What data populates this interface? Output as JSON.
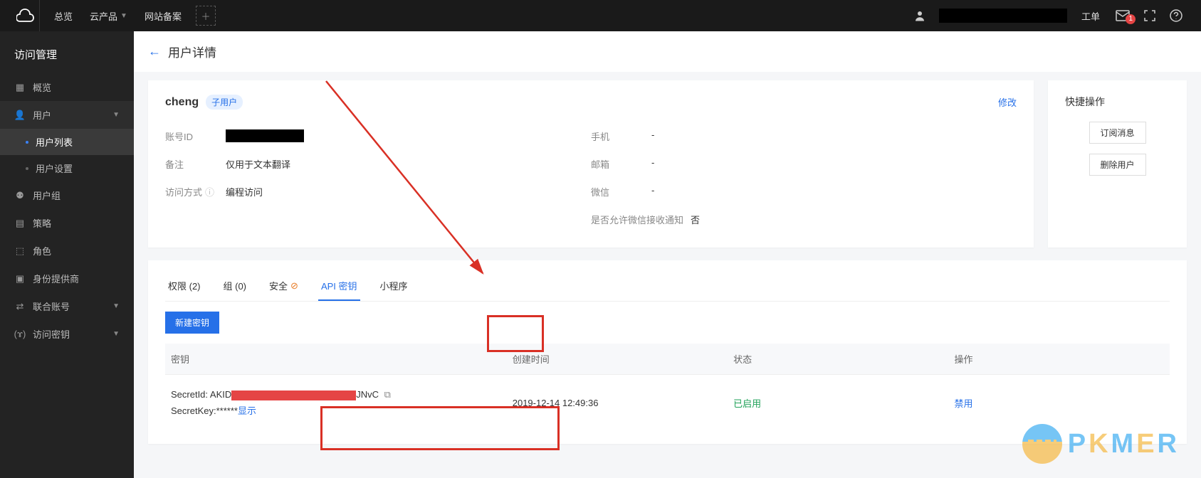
{
  "topnav": {
    "overview": "总览",
    "products": "云产品",
    "beian": "网站备案",
    "ticket": "工单"
  },
  "mail_badge": "1",
  "sidebar": {
    "title": "访问管理",
    "items": [
      {
        "label": "概览"
      },
      {
        "label": "用户"
      },
      {
        "label": "用户列表"
      },
      {
        "label": "用户设置"
      },
      {
        "label": "用户组"
      },
      {
        "label": "策略"
      },
      {
        "label": "角色"
      },
      {
        "label": "身份提供商"
      },
      {
        "label": "联合账号"
      },
      {
        "label": "访问密钥"
      }
    ]
  },
  "page": {
    "title": "用户详情"
  },
  "user": {
    "name": "cheng",
    "badge": "子用户",
    "edit": "修改",
    "labels": {
      "id": "账号ID",
      "remark": "备注",
      "access": "访问方式",
      "phone": "手机",
      "email": "邮箱",
      "wechat": "微信",
      "wechat_notify": "是否允许微信接收通知"
    },
    "values": {
      "remark": "仅用于文本翻译",
      "access": "编程访问",
      "phone": "-",
      "email": "-",
      "wechat": "-",
      "wechat_notify": "否"
    }
  },
  "quick": {
    "title": "快捷操作",
    "subscribe": "订阅消息",
    "delete": "删除用户"
  },
  "tabs": {
    "perm": "权限 (2)",
    "group": "组 (0)",
    "security": "安全",
    "apikey": "API 密钥",
    "miniapp": "小程序"
  },
  "key_section": {
    "create": "新建密钥",
    "headers": {
      "key": "密钥",
      "created": "创建时间",
      "status": "状态",
      "action": "操作"
    },
    "secret_id_label": "SecretId: ",
    "secret_id_prefix": "AKID",
    "secret_id_suffix": "JNvC",
    "secret_key_label": "SecretKey:",
    "secret_key_mask": "******",
    "show": "显示",
    "created_at": "2019-12-14 12:49:36",
    "status": "已启用",
    "action": "禁用"
  },
  "watermark": "PKMER"
}
